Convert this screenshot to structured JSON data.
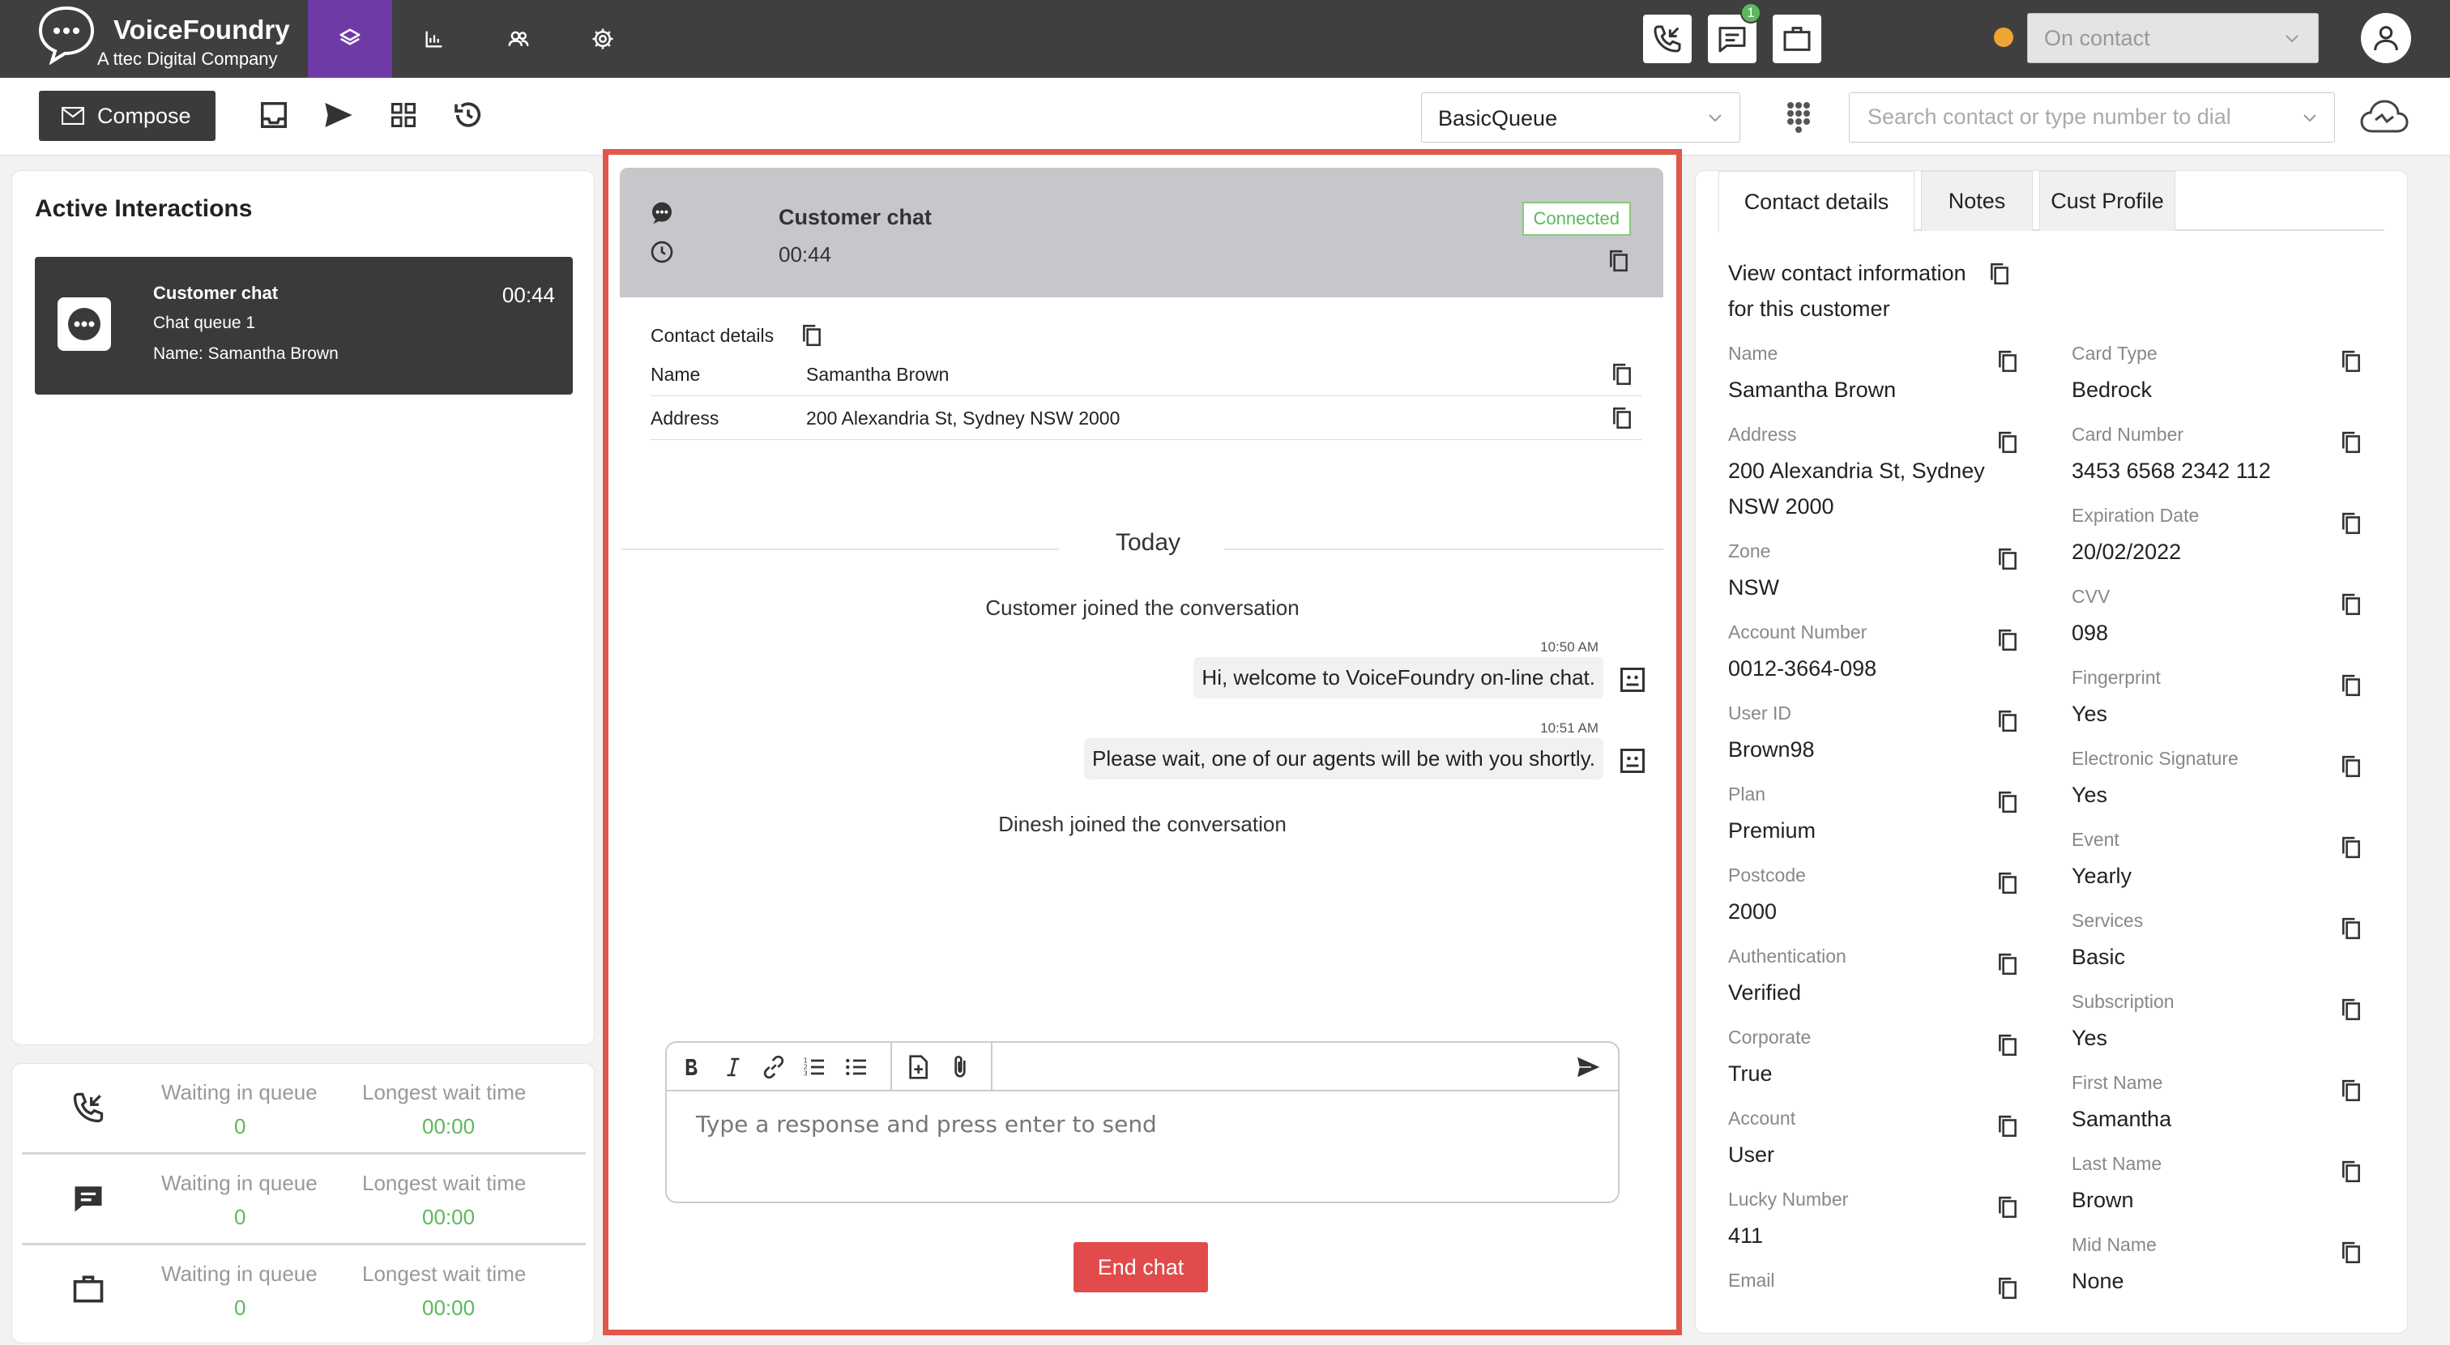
{
  "brand": {
    "name": "VoiceFoundry",
    "sub": "A ttec Digital Company"
  },
  "nav": {
    "tabs": [
      "layers-icon",
      "bar-chart-icon",
      "users-icon",
      "gear-icon"
    ],
    "active": 0
  },
  "notifications": {
    "chat_badge": "1"
  },
  "agent_status": {
    "value": "On contact",
    "dot_color": "#f0a431"
  },
  "toolbar": {
    "compose_label": "Compose",
    "queue_value": "BasicQueue",
    "search_placeholder": "Search contact or type number to dial"
  },
  "left": {
    "title": "Active Interactions",
    "card": {
      "title": "Customer chat",
      "queue": "Chat queue 1",
      "name": "Name: Samantha Brown",
      "time": "00:44"
    },
    "queues": [
      {
        "icon": "phone-incoming-icon",
        "waiting_label": "Waiting in queue",
        "waiting": "0",
        "longest_label": "Longest wait time",
        "longest": "00:00"
      },
      {
        "icon": "chat-icon",
        "waiting_label": "Waiting in queue",
        "waiting": "0",
        "longest_label": "Longest wait time",
        "longest": "00:00"
      },
      {
        "icon": "briefcase-icon",
        "waiting_label": "Waiting in queue",
        "waiting": "0",
        "longest_label": "Longest wait time",
        "longest": "00:00"
      }
    ]
  },
  "chat": {
    "title": "Customer chat",
    "time": "00:44",
    "status": "Connected",
    "contact_title": "Contact details",
    "contact_rows": [
      {
        "key": "Name",
        "value": "Samantha Brown"
      },
      {
        "key": "Address",
        "value": "200 Alexandria St, Sydney NSW 2000"
      }
    ],
    "day": "Today",
    "messages": {
      "join1": "Customer joined the conversation",
      "time1": "10:50 AM",
      "msg1": "Hi, welcome to VoiceFoundry on-line chat.",
      "time2": "10:51 AM",
      "msg2": "Please wait, one of our agents will be with you shortly.",
      "join2": "Dinesh joined the conversation"
    },
    "input_placeholder": "Type a response and press enter to send",
    "end_label": "End chat"
  },
  "right": {
    "tabs": [
      "Contact details",
      "Notes",
      "Cust Profile"
    ],
    "active_tab": 0,
    "intro": "View contact information for this customer",
    "left_fields": [
      {
        "label": "Name",
        "value": "Samantha Brown"
      },
      {
        "label": "Address",
        "value": "200 Alexandria St, Sydney NSW 2000"
      },
      {
        "label": "Zone",
        "value": "NSW"
      },
      {
        "label": "Account Number",
        "value": "0012-3664-098"
      },
      {
        "label": "User ID",
        "value": "Brown98"
      },
      {
        "label": "Plan",
        "value": "Premium"
      },
      {
        "label": "Postcode",
        "value": "2000"
      },
      {
        "label": "Authentication",
        "value": "Verified"
      },
      {
        "label": "Corporate",
        "value": "True"
      },
      {
        "label": "Account",
        "value": "User"
      },
      {
        "label": "Lucky Number",
        "value": "411"
      },
      {
        "label": "Email",
        "value": ""
      }
    ],
    "right_fields": [
      {
        "label": "Card Type",
        "value": "Bedrock"
      },
      {
        "label": "Card Number",
        "value": "3453 6568 2342 112"
      },
      {
        "label": "Expiration Date",
        "value": "20/02/2022"
      },
      {
        "label": "CVV",
        "value": "098"
      },
      {
        "label": "Fingerprint",
        "value": "Yes"
      },
      {
        "label": "Electronic Signature",
        "value": "Yes"
      },
      {
        "label": "Event",
        "value": "Yearly"
      },
      {
        "label": "Services",
        "value": "Basic"
      },
      {
        "label": "Subscription",
        "value": "Yes"
      },
      {
        "label": "First Name",
        "value": "Samantha"
      },
      {
        "label": "Last Name",
        "value": "Brown"
      },
      {
        "label": "Mid Name",
        "value": "None"
      }
    ]
  },
  "colors": {
    "accent": "#6f3aa6",
    "connected": "#5cb85c",
    "end_chat": "#e14b4b",
    "highlight_border": "#e0574b"
  }
}
